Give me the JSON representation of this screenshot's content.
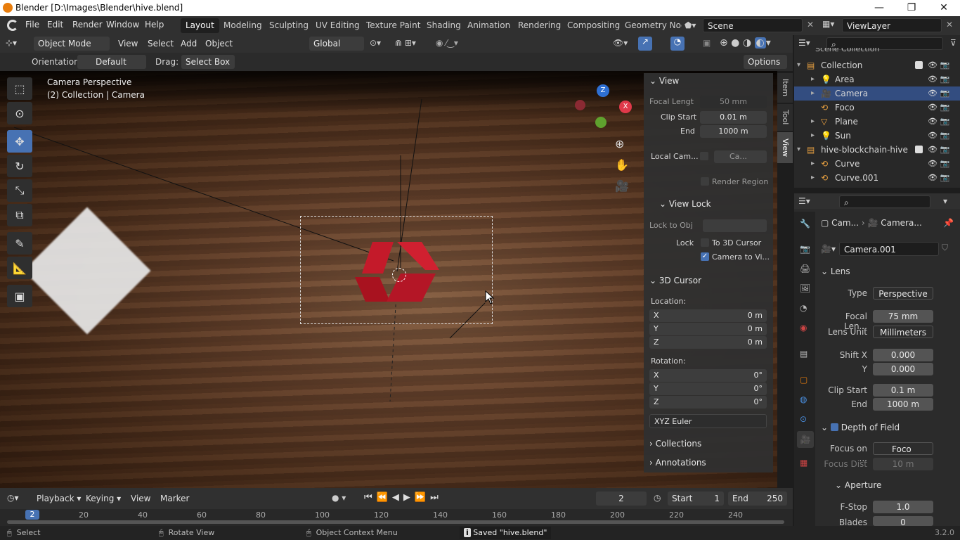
{
  "window": {
    "title": "Blender [D:\\Images\\Blender\\hive.blend]",
    "min": "—",
    "max": "❐",
    "close": "✕"
  },
  "menu": [
    "File",
    "Edit",
    "Render",
    "Window",
    "Help"
  ],
  "workspaces": [
    "Layout",
    "Modeling",
    "Sculpting",
    "UV Editing",
    "Texture Paint",
    "Shading",
    "Animation",
    "Rendering",
    "Compositing",
    "Geometry Noc"
  ],
  "scene": "Scene",
  "viewlayer": "ViewLayer",
  "header3d": {
    "mode": "Object Mode",
    "menus": [
      "View",
      "Select",
      "Add",
      "Object"
    ],
    "transform": "Global"
  },
  "tooldrawer": {
    "orientation_label": "Orientation:",
    "orientation": "Default",
    "drag_label": "Drag:",
    "drag": "Select Box",
    "options": "Options"
  },
  "viewport": {
    "line1": "Camera Perspective",
    "line2": "(2) Collection | Camera",
    "gizmo": {
      "z": "Z",
      "x": "X"
    }
  },
  "npanel": {
    "tabs": [
      "Item",
      "Tool",
      "View"
    ],
    "view": {
      "title": "View",
      "focal_label": "Focal Lengt",
      "focal": "50 mm",
      "clipstart_label": "Clip Start",
      "clipstart": "0.01 m",
      "end_label": "End",
      "end": "1000 m",
      "localcam_label": "Local Cam...",
      "localcam": "Ca...",
      "render_region": "Render Region"
    },
    "viewlock": {
      "title": "View Lock",
      "lockobj_label": "Lock to Obj",
      "lock_label": "Lock",
      "to3d": "To 3D Cursor",
      "camtoview": "Camera to Vi..."
    },
    "cursor": {
      "title": "3D Cursor",
      "location": "Location:",
      "x": "0 m",
      "y": "0 m",
      "z": "0 m",
      "rotation": "Rotation:",
      "rx": "0°",
      "ry": "0°",
      "rz": "0°",
      "mode": "XYZ Euler",
      "lx": "X",
      "ly": "Y",
      "lz": "Z"
    },
    "collections": "Collections",
    "annotations": "Annotations"
  },
  "outliner": {
    "top": "Scene Collection",
    "rows": [
      {
        "name": "Collection",
        "indent": 1
      },
      {
        "name": "Area",
        "indent": 2
      },
      {
        "name": "Camera",
        "indent": 2,
        "selected": true
      },
      {
        "name": "Foco",
        "indent": 2
      },
      {
        "name": "Plane",
        "indent": 2
      },
      {
        "name": "Sun",
        "indent": 2
      },
      {
        "name": "hive-blockchain-hive",
        "indent": 1
      },
      {
        "name": "Curve",
        "indent": 2
      },
      {
        "name": "Curve.001",
        "indent": 2
      }
    ]
  },
  "props": {
    "breadcrumb1": "Cam...",
    "breadcrumb2": "Camera...",
    "datablock": "Camera.001",
    "lens": {
      "title": "Lens",
      "type_label": "Type",
      "type": "Perspective",
      "focal_label": "Focal Len...",
      "focal": "75 mm",
      "unit_label": "Lens Unit",
      "unit": "Millimeters",
      "shiftx_label": "Shift X",
      "shiftx": "0.000",
      "shifty_label": "Y",
      "shifty": "0.000",
      "clipstart_label": "Clip Start",
      "clipstart": "0.1 m",
      "end_label": "End",
      "end": "1000 m"
    },
    "dof": {
      "title": "Depth of Field",
      "focuson_label": "Focus on ...",
      "focuson": "Foco",
      "focusdist_label": "Focus Dist",
      "focusdist": "10 m"
    },
    "aperture": {
      "title": "Aperture",
      "fstop_label": "F-Stop",
      "fstop": "1.0",
      "blades_label": "Blades",
      "blades": "0"
    }
  },
  "timeline": {
    "playback": "Playback",
    "keying": "Keying",
    "view": "View",
    "marker": "Marker",
    "frame": "2",
    "start_label": "Start",
    "start": "1",
    "end_label": "End",
    "end": "250",
    "current": "2",
    "ticks": [
      "20",
      "40",
      "60",
      "80",
      "100",
      "120",
      "140",
      "160",
      "180",
      "200",
      "220",
      "240"
    ]
  },
  "status": {
    "select": "Select",
    "rotate": "Rotate View",
    "context": "Object Context Menu",
    "saved": "Saved \"hive.blend\"",
    "version": "3.2.0"
  }
}
